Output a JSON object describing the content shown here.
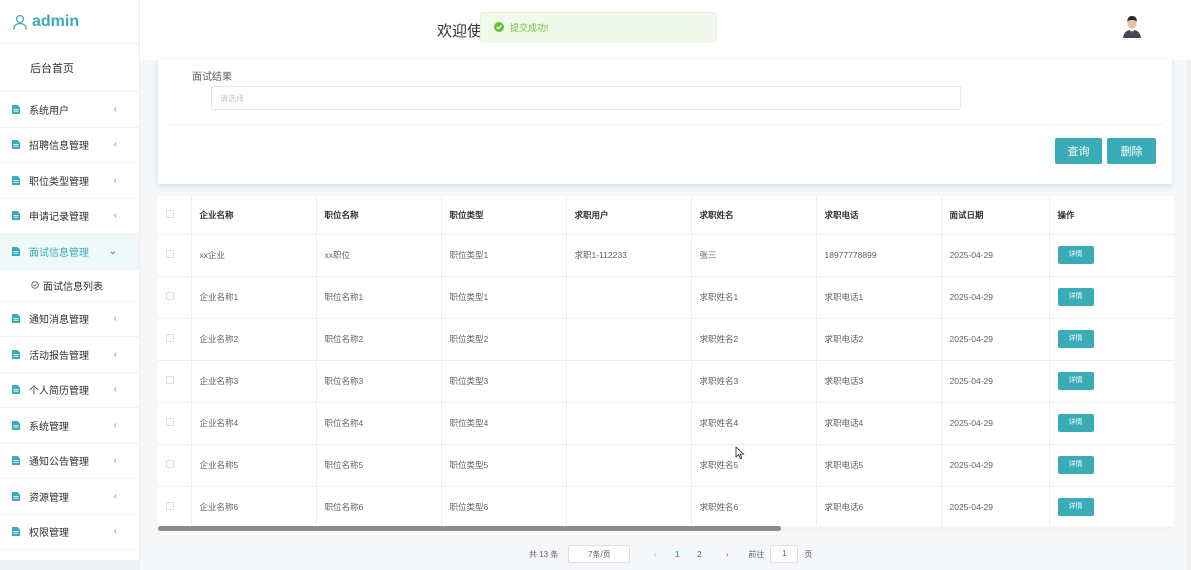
{
  "brand": {
    "title": "admin"
  },
  "sidebar": {
    "home": "后台首页",
    "items": [
      {
        "label": "系统用户"
      },
      {
        "label": "招聘信息管理"
      },
      {
        "label": "职位类型管理"
      },
      {
        "label": "申请记录管理"
      },
      {
        "label": "面试信息管理"
      },
      {
        "label": "通知消息管理"
      },
      {
        "label": "活动报告管理"
      },
      {
        "label": "个人简历管理"
      },
      {
        "label": "系统管理"
      },
      {
        "label": "通知公告管理"
      },
      {
        "label": "资源管理"
      },
      {
        "label": "权限管理"
      }
    ],
    "submenu": {
      "label": "面试信息列表"
    }
  },
  "header": {
    "welcome": "欢迎使"
  },
  "toast": {
    "message": "提交成功!"
  },
  "search": {
    "field_label": "面试结果",
    "placeholder": "请选择",
    "query_label": "查询",
    "delete_label": "删除"
  },
  "table": {
    "headers": [
      "企业名称",
      "职位名称",
      "职位类型",
      "求职用户",
      "求职姓名",
      "求职电话",
      "面试日期",
      "操作"
    ],
    "detail_label": "详情",
    "rows": [
      [
        "xx企业",
        "xx职位",
        "职位类型1",
        "求职1-112233",
        "张三",
        "18977778899",
        "2025-04-29"
      ],
      [
        "企业名称1",
        "职位名称1",
        "职位类型1",
        "",
        "求职姓名1",
        "求职电话1",
        "2025-04-29"
      ],
      [
        "企业名称2",
        "职位名称2",
        "职位类型2",
        "",
        "求职姓名2",
        "求职电话2",
        "2025-04-29"
      ],
      [
        "企业名称3",
        "职位名称3",
        "职位类型3",
        "",
        "求职姓名3",
        "求职电话3",
        "2025-04-29"
      ],
      [
        "企业名称4",
        "职位名称4",
        "职位类型4",
        "",
        "求职姓名4",
        "求职电话4",
        "2025-04-29"
      ],
      [
        "企业名称5",
        "职位名称5",
        "职位类型5",
        "",
        "求职姓名5",
        "求职电话5",
        "2025-04-29"
      ],
      [
        "企业名称6",
        "职位名称6",
        "职位类型6",
        "",
        "求职姓名6",
        "求职电话6",
        "2025-04-29"
      ]
    ]
  },
  "pagination": {
    "total": "共 13 条",
    "page_size": "7条/页",
    "prev": "‹",
    "next": "›",
    "pages": [
      "1",
      "2"
    ],
    "goto_prefix": "前往",
    "goto_value": "1",
    "goto_suffix": "页"
  },
  "colors": {
    "accent": "#3aacb7",
    "toast_bg": "#f0f9eb",
    "toast_text": "#67c23a"
  },
  "icons": {
    "brand": "user-icon",
    "menu": "document-icon",
    "submenu": "clock-icon",
    "collapse": "chevron-left-icon",
    "expanded": "chevron-down-icon",
    "toast": "check-circle-icon"
  }
}
